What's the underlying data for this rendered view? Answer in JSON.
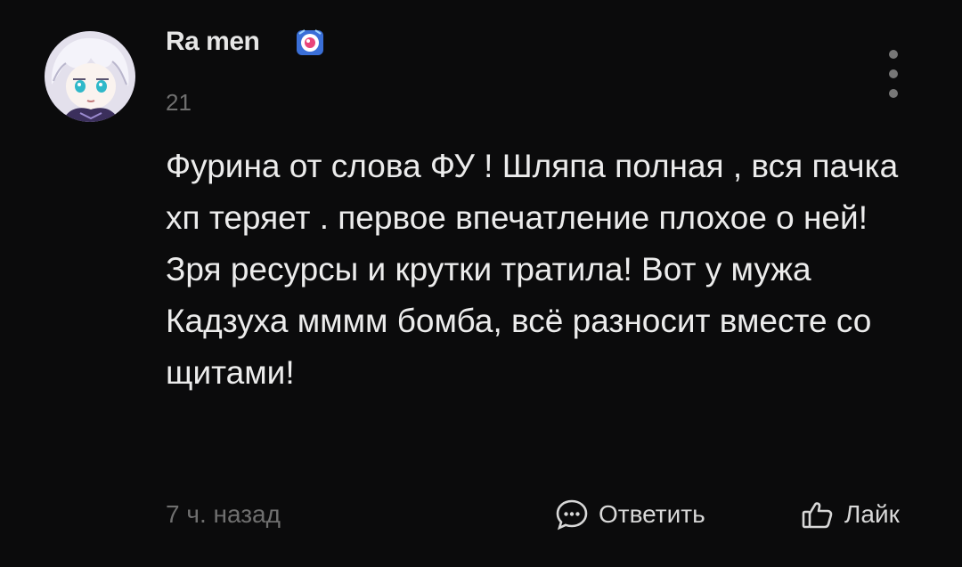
{
  "comment": {
    "author": "Ra men",
    "level": "21",
    "text": "Фурина от слова ФУ ! Шляпа полная , вся пачка хп теряет . первое впечатление плохое о ней! Зря ресурсы и крутки тратила! Вот у мужа Кадзуха мммм бомба, всё разносит вместе со щитами!",
    "time": "7 ч. назад",
    "actions": {
      "reply_label": "Ответить",
      "like_label": "Лайк"
    }
  },
  "icons": {
    "avatar": "avatar-image",
    "badge": "fan-badge-icon",
    "more": "more-vertical-icon",
    "reply": "chat-bubble-icon",
    "like": "thumbs-up-icon"
  },
  "colors": {
    "background": "#0b0b0c",
    "text_primary": "#ececec",
    "text_secondary": "#6f6f6f"
  }
}
